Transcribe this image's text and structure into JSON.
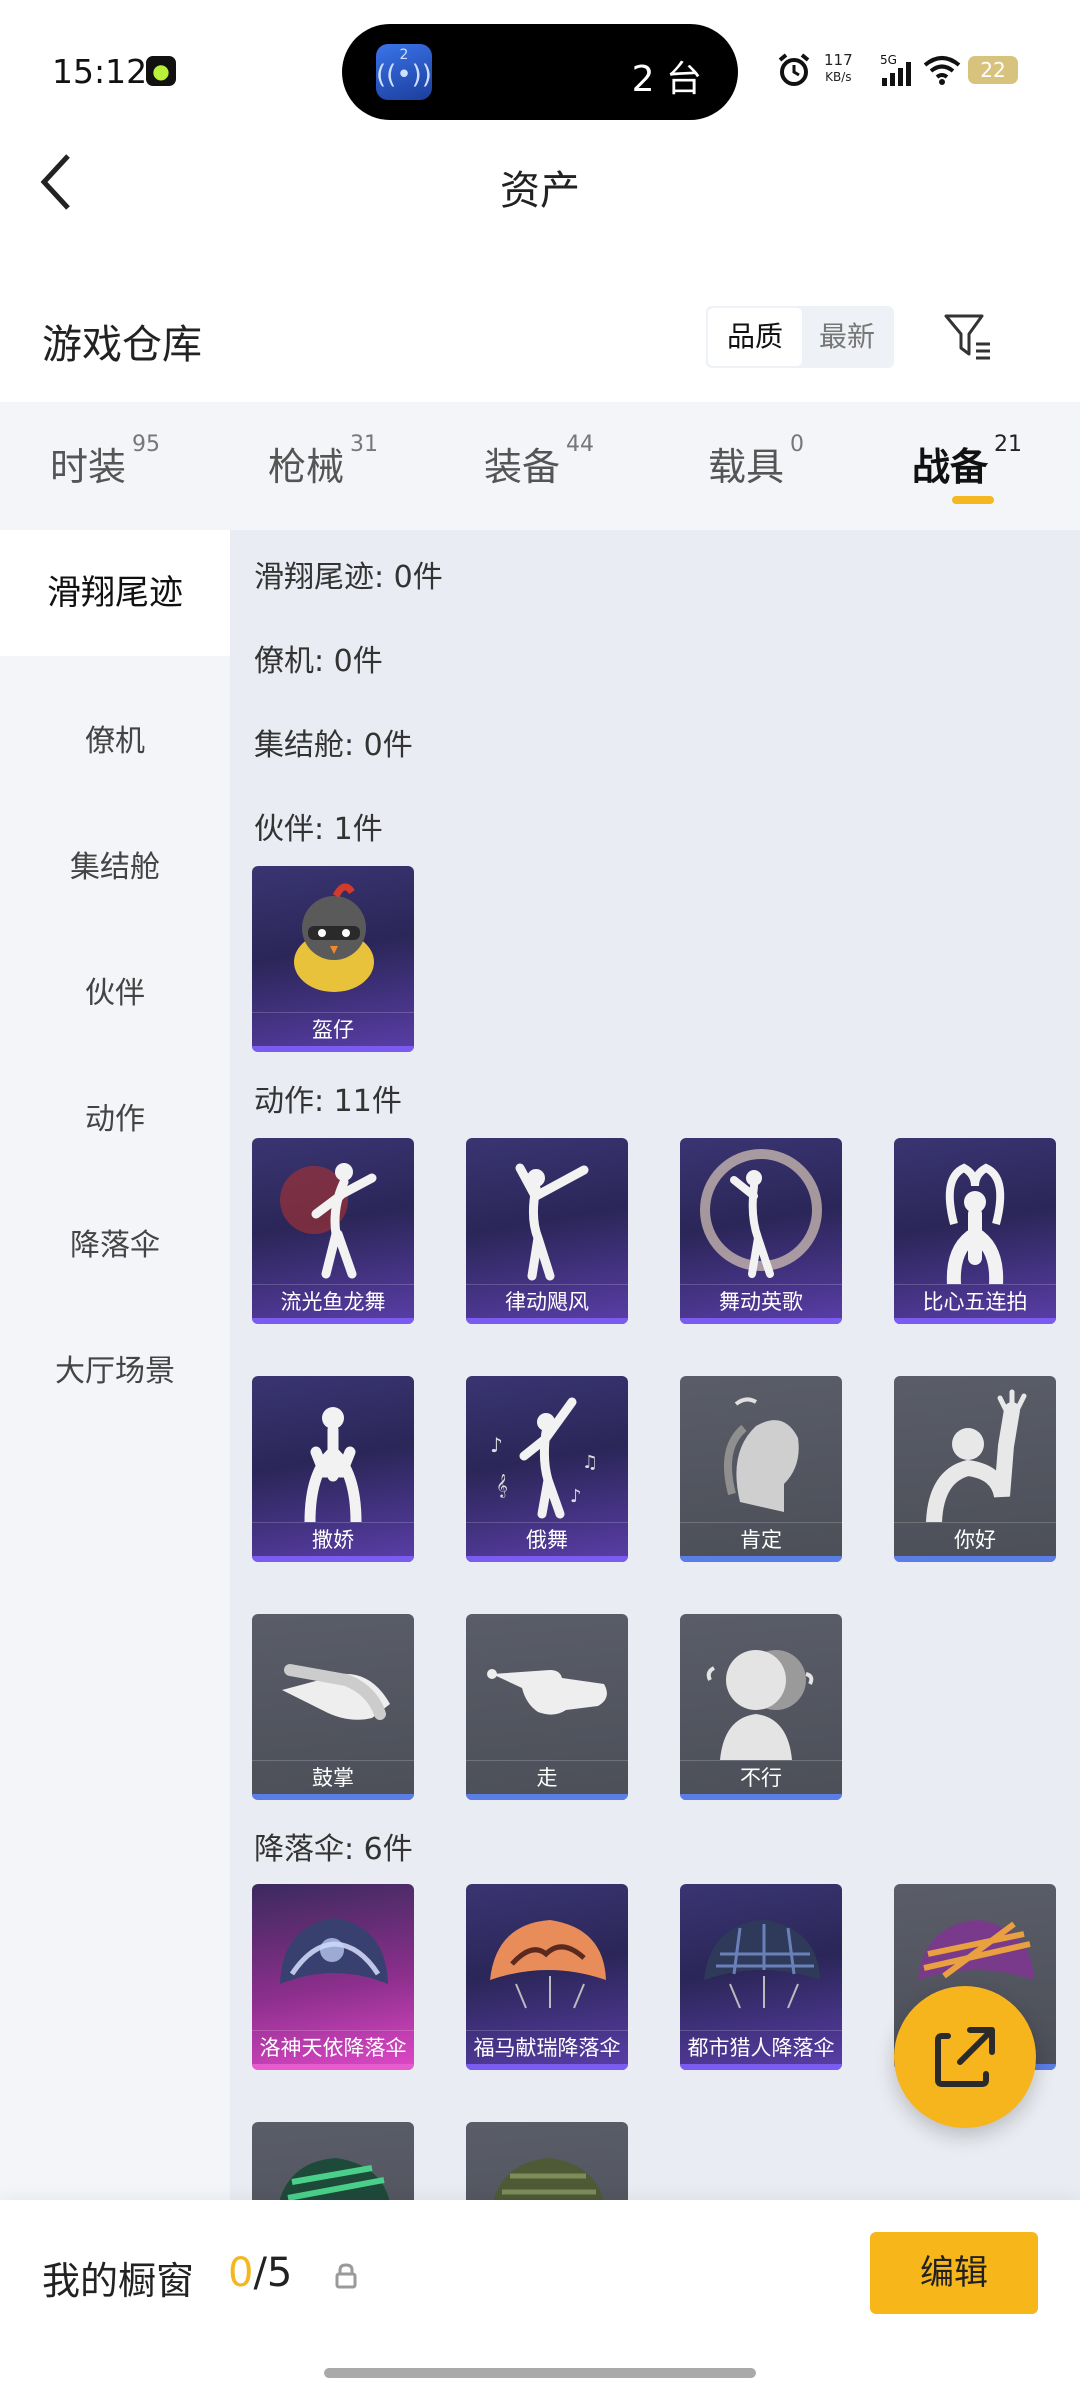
{
  "status_bar": {
    "time": "15:12",
    "island_text": "2 台",
    "island_app_badge": "2",
    "net_speed_value": "117",
    "net_speed_unit": "KB/s",
    "network": "5G",
    "battery": "22"
  },
  "header": {
    "title": "资产"
  },
  "section": {
    "title": "游戏仓库",
    "sort_active": "品质",
    "sort_inactive": "最新"
  },
  "tabs": [
    {
      "label": "时装",
      "count": "95"
    },
    {
      "label": "枪械",
      "count": "31"
    },
    {
      "label": "装备",
      "count": "44"
    },
    {
      "label": "载具",
      "count": "0"
    },
    {
      "label": "战备",
      "count": "21"
    }
  ],
  "sidebar": [
    "滑翔尾迹",
    "僚机",
    "集结舱",
    "伙伴",
    "动作",
    "降落伞",
    "大厅场景"
  ],
  "categories": {
    "trail": "滑翔尾迹: 0件",
    "wingman": "僚机: 0件",
    "capsule": "集结舱: 0件",
    "partner": "伙伴: 1件",
    "emote": "动作: 11件",
    "parachute": "降落伞: 6件"
  },
  "partner_items": [
    "盔仔"
  ],
  "emote_items": [
    "流光鱼龙舞",
    "律动飓风",
    "舞动英歌",
    "比心五连拍",
    "撒娇",
    "俄舞",
    "肯定",
    "你好",
    "鼓掌",
    "走",
    "不行"
  ],
  "parachute_items": [
    "洛神天依降落伞",
    "福马献瑞降落伞",
    "都市猎人降落伞"
  ],
  "bottom": {
    "showcase_label": "我的橱窗",
    "count_current": "0",
    "count_total": "/5",
    "edit_label": "编辑"
  },
  "colors": {
    "accent": "#f4b71f",
    "rare_bar": "#7a5cf0",
    "common_bar": "#5b7ee6",
    "legend_bar": "#e65ccf"
  }
}
